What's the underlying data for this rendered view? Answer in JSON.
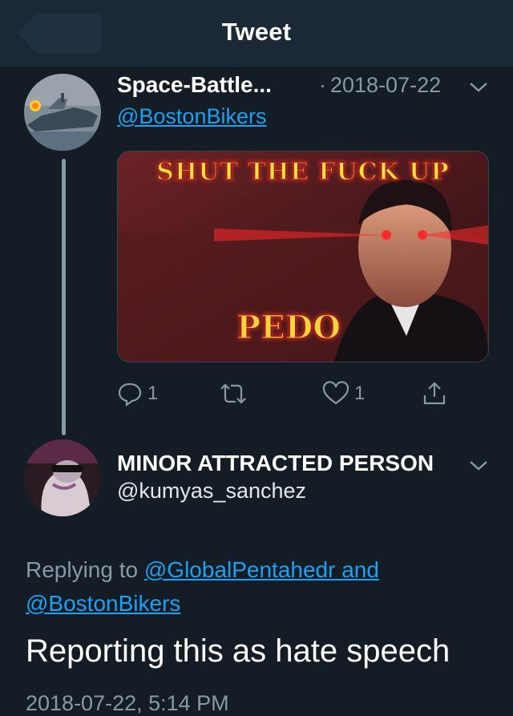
{
  "header": {
    "title": "Tweet"
  },
  "parent_tweet": {
    "display_name": "Space-Battle...",
    "separator": "·",
    "date": "2018-07-22",
    "handle": "@BostonBikers",
    "media": {
      "top_text": "SHUT THE FUCK UP",
      "bottom_text": "PEDO"
    },
    "actions": {
      "reply_count": "1",
      "like_count": "1"
    }
  },
  "reply_tweet": {
    "display_name": "MINOR ATTRACTED PERSON",
    "handle": "@kumyas_sanchez",
    "replying_prefix": "Replying to",
    "replying_users": "@GlobalPentahedr and",
    "replying_users_2": "@BostonBikers",
    "body": "Reporting this as hate speech",
    "timestamp": "2018-07-22, 5:14 PM"
  },
  "colors": {
    "background": "#141d26",
    "link": "#1da1f2",
    "muted": "#8899a6"
  }
}
